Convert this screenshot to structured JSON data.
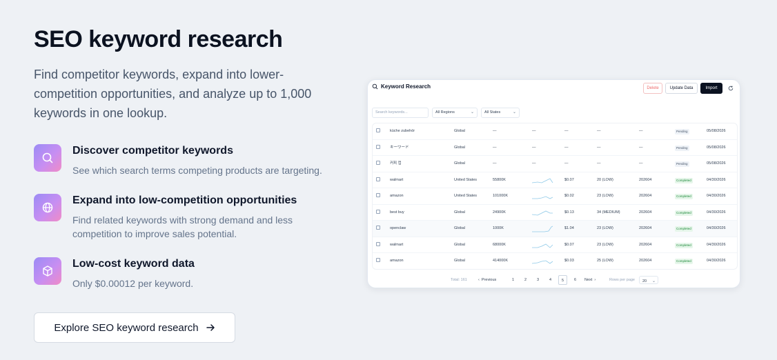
{
  "hero": {
    "title": "SEO keyword research",
    "subtitle": "Find competitor keywords, expand into lower-competition opportunities, and analyze up to 1,000 keywords in one lookup."
  },
  "features": [
    {
      "icon": "search-icon",
      "title": "Discover competitor keywords",
      "desc": "See which search terms competing products are targeting."
    },
    {
      "icon": "globe-icon",
      "title": "Expand into low-competition opportunities",
      "desc": "Find related keywords with strong demand and less competition to improve sales potential."
    },
    {
      "icon": "box-icon",
      "title": "Low-cost keyword data",
      "desc": "Only $0.00012 per keyword."
    }
  ],
  "cta": {
    "label": "Explore SEO keyword research",
    "icon": "arrow-right-icon"
  },
  "preview": {
    "title": "Keyword Research",
    "delete_label": "Delete",
    "update_label": "Update Data",
    "import_label": "Import",
    "search_placeholder": "Search keywords...",
    "region_select": "All Regions",
    "state_select": "All States",
    "rows": [
      {
        "keyword": "küche zubehör",
        "region": "Global",
        "volume": "—",
        "trend": "—",
        "cpc": "—",
        "competition": "—",
        "updated": "—",
        "status": "Pending",
        "date": "05/08/2026"
      },
      {
        "keyword": "キーワード",
        "region": "Global",
        "volume": "—",
        "trend": "—",
        "cpc": "—",
        "competition": "—",
        "updated": "—",
        "status": "Pending",
        "date": "05/08/2026"
      },
      {
        "keyword": "커피 컵",
        "region": "Global",
        "volume": "—",
        "trend": "—",
        "cpc": "—",
        "competition": "—",
        "updated": "—",
        "status": "Pending",
        "date": "05/08/2026"
      },
      {
        "keyword": "walmart",
        "region": "United States",
        "volume": "55800K",
        "trend": "sparkline",
        "cpc": "$0.07",
        "competition": "20 (LOW)",
        "updated": "202604",
        "status": "Completed",
        "date": "04/30/2026"
      },
      {
        "keyword": "amazon",
        "region": "United States",
        "volume": "101000K",
        "trend": "sparkline",
        "cpc": "$0.02",
        "competition": "23 (LOW)",
        "updated": "202604",
        "status": "Completed",
        "date": "04/30/2026"
      },
      {
        "keyword": "best buy",
        "region": "Global",
        "volume": "24900K",
        "trend": "sparkline",
        "cpc": "$0.13",
        "competition": "34 (MEDIUM)",
        "updated": "202604",
        "status": "Completed",
        "date": "04/30/2026"
      },
      {
        "keyword": "openclaw",
        "region": "Global",
        "volume": "1000K",
        "trend": "sparkline",
        "cpc": "$1.04",
        "competition": "23 (LOW)",
        "updated": "202604",
        "status": "Completed",
        "date": "04/30/2026"
      },
      {
        "keyword": "walmart",
        "region": "Global",
        "volume": "68000K",
        "trend": "sparkline",
        "cpc": "$0.07",
        "competition": "23 (LOW)",
        "updated": "202604",
        "status": "Completed",
        "date": "04/30/2026"
      },
      {
        "keyword": "amazon",
        "region": "Global",
        "volume": "414000K",
        "trend": "sparkline",
        "cpc": "$0.03",
        "competition": "25 (LOW)",
        "updated": "202604",
        "status": "Completed",
        "date": "04/30/2026"
      }
    ],
    "footer": {
      "total": "Total: 161",
      "previous": "Previous",
      "pages": [
        "1",
        "2",
        "3",
        "4",
        "5",
        "6"
      ],
      "active_page": "5",
      "next": "Next",
      "rows_per_page_label": "Rows per page",
      "rows_per_page": "20"
    }
  },
  "colors": {
    "background": "#eef1f5",
    "accent_gradient_start": "#9b8cf5",
    "accent_gradient_end": "#f08bc6",
    "completed_green": "#1f8a3b",
    "delete_red": "#ef6b6b",
    "sparkline": "#8ec9e8"
  }
}
